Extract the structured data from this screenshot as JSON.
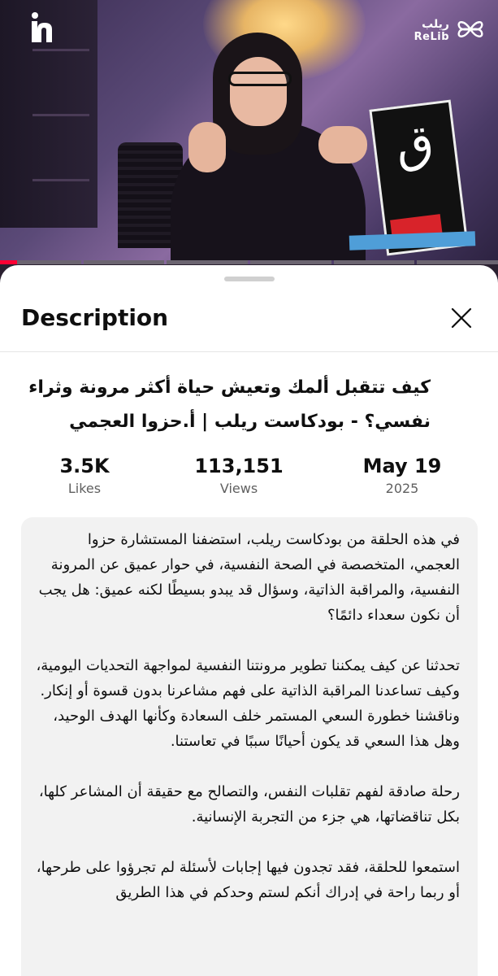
{
  "video": {
    "app_logo_letter": "h",
    "sign_letter": "ق",
    "progress_fraction": 0.035
  },
  "brand": {
    "name_ar": "ريلب",
    "name_en": "ReLib"
  },
  "sheet": {
    "title": "Description",
    "close_icon": "close-icon"
  },
  "video_title": "كيف تتقبل ألمك وتعيش حياة أكثر مرونة وثراء نفسي؟ - بودكاست ريلب | أ.حزوا العجمي",
  "stats": {
    "likes": {
      "value": "3.5K",
      "label": "Likes"
    },
    "views": {
      "value": "113,151",
      "label": "Views"
    },
    "date": {
      "value": "May 19",
      "label": "2025"
    }
  },
  "description": [
    "في هذه الحلقة من بودكاست ريلب، استضفنا المستشارة حزوا العجمي، المتخصصة في الصحة النفسية، في حوار عميق عن المرونة النفسية، والمراقبة الذاتية، وسؤال قد يبدو بسيطًا لكنه عميق: هل يجب أن نكون سعداء دائمًا؟",
    "تحدثنا عن كيف يمكننا تطوير مرونتنا النفسية لمواجهة التحديات اليومية، وكيف تساعدنا المراقبة الذاتية على فهم مشاعرنا بدون قسوة أو إنكار. وناقشنا خطورة السعي المستمر خلف السعادة وكأنها الهدف الوحيد، وهل هذا السعي قد يكون أحيانًا سببًا في تعاستنا.",
    "رحلة صادقة لفهم تقلبات النفس، والتصالح مع حقيقة أن المشاعر كلها، بكل تناقضاتها، هي جزء من التجربة الإنسانية.",
    "استمعوا للحلقة، فقد تجدون فيها إجابات لأسئلة لم تجرؤوا على طرحها، أو ربما راحة في إدراك أنكم لستم وحدكم في هذا الطريق"
  ],
  "colors": {
    "accent_red": "#ff0033",
    "text_primary": "#0f0f0f",
    "text_secondary": "#606060",
    "desc_background": "#f2f2f2"
  }
}
